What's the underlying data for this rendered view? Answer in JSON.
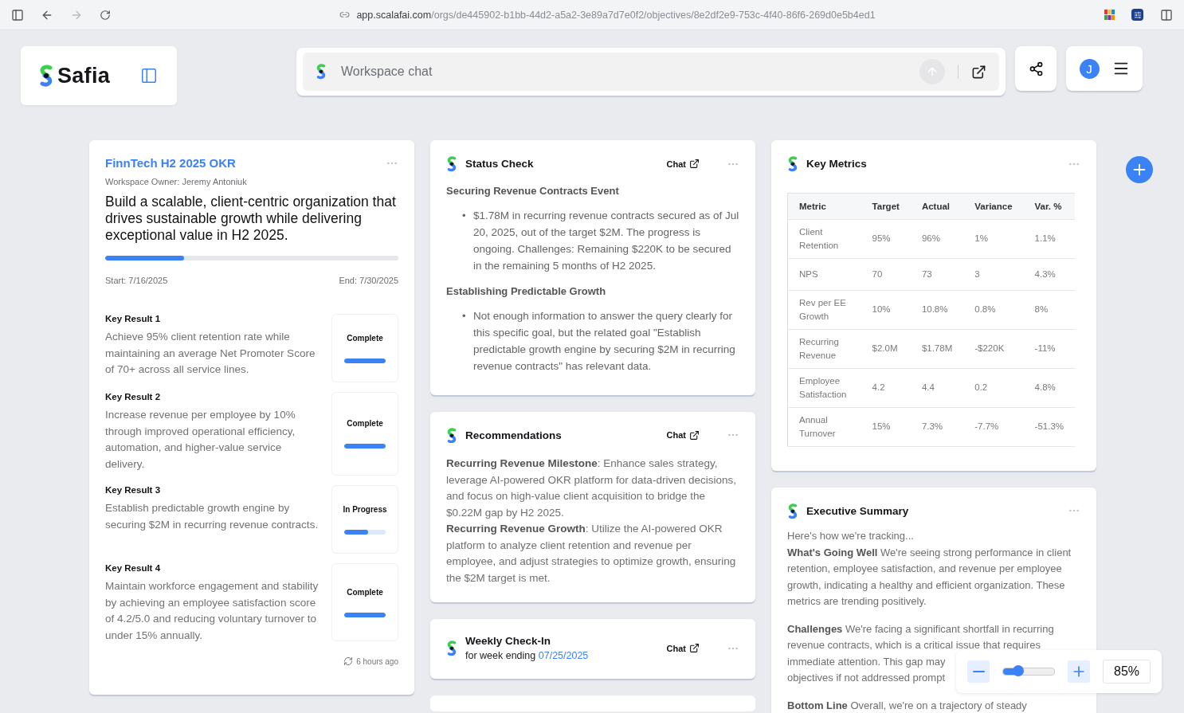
{
  "browser": {
    "url": "**app.scalafai.com**/orgs/de445902-b1bb-44d2-a5a2-3e89a7d7e0f2/objectives/8e2df2e9-753c-4f40-86f6-269d0e5b4ed1",
    "forward_disabled": true
  },
  "brand": {
    "name": "Safia"
  },
  "chat_bar": {
    "placeholder": "Workspace chat",
    "send_disabled": true
  },
  "user": {
    "avatar": "J"
  },
  "objective": {
    "title": "FinnTech H2 2025 OKR",
    "owner": "Workspace Owner: Jeremy Antoniuk",
    "statement": "Build a scalable, client-centric organization that drives sustainable growth while delivering exceptional value in H2 2025.",
    "level": 0.27,
    "start": "Start: 7/16/2025",
    "end": "End: 7/30/2025",
    "key_results": [
      {
        "label": "Key Result 1",
        "text": "Achieve 95% client retention rate while maintaining an average Net Promoter Score of 70+ across all service lines.",
        "status": "Complete",
        "level": 1
      },
      {
        "label": "Key Result 2",
        "text": "Increase revenue per employee by 10% through improved operational efficiency, automation, and higher-value service delivery.",
        "status": "Complete",
        "level": 1
      },
      {
        "label": "Key Result 3",
        "text": "Establish predictable growth engine by securing $2M in recurring revenue contracts.",
        "status": "In Progress",
        "level": 0.58
      },
      {
        "label": "Key Result 4",
        "text": "Maintain workforce engagement and stability by achieving an employee satisfaction score of 4.2/5.0 and reducing voluntary turnover to under 15% annually.",
        "status": "Complete",
        "level": 1
      }
    ],
    "updated": "6 hours ago"
  },
  "status_check": {
    "title": "Status Check",
    "chat": "Chat",
    "marker": "•",
    "sections": [
      {
        "heading": "Securing Revenue Contracts Event",
        "bullets": [
          "$1.78M in recurring revenue contracts secured as of Jul 20, 2025, out of the target $2M. The progress is ongoing. Challenges: Remaining $220K to be secured in the remaining 5 months of H2 2025."
        ]
      },
      {
        "heading": "Establishing Predictable Growth",
        "bullets": [
          "Not enough information to answer the query clearly for this specific goal, but the related goal \"Establish predictable growth engine by securing $2M in recurring revenue contracts\" has relevant data."
        ]
      }
    ]
  },
  "recommendations": {
    "title": "Recommendations",
    "chat": "Chat",
    "paragraphs": [
      "**Recurring Revenue Milestone**: Enhance sales strategy, leverage AI-powered OKR platform for data-driven decisions, and focus on high-value client acquisition to bridge the $0.22M gap by H2 2025.",
      "**Recurring Revenue Growth**: Utilize the AI-powered OKR platform to analyze client retention and revenue per employee, and adjust strategies to optimize growth, ensuring the $2M target is met."
    ]
  },
  "weekly_checkin": {
    "title": "Weekly Check-In",
    "subtitle": "for week ending",
    "date": "07/25/2025",
    "chat": "Chat"
  },
  "key_metrics": {
    "title": "Key Metrics",
    "columns": [
      "Metric",
      "Target",
      "Actual",
      "Variance",
      "Var. %"
    ],
    "rows": [
      [
        "Client Retention",
        "95%",
        "96%",
        "1%",
        "1.1%"
      ],
      [
        "NPS",
        "70",
        "73",
        "3",
        "4.3%"
      ],
      [
        "Rev per EE Growth",
        "10%",
        "10.8%",
        "0.8%",
        "8%"
      ],
      [
        "Recurring Revenue",
        "$2.0M",
        "$1.78M",
        "-$220K",
        "-11%"
      ],
      [
        "Employee Satisfaction",
        "4.2",
        "4.4",
        "0.2",
        "4.8%"
      ],
      [
        "Annual Turnover",
        "15%",
        "7.3%",
        "-7.7%",
        "-51.3%"
      ]
    ]
  },
  "executive_summary": {
    "title": "Executive Summary",
    "paragraphs": [
      [
        "Here's how we're tracking...",
        "**What's Going Well** We're seeing strong performance in client retention, employee satisfaction, and revenue per employee growth, indicating a healthy and efficient organization. These metrics are trending positively."
      ],
      [
        "**Challenges** We're facing a significant shortfall in recurring revenue contracts, which is a critical issue that requires",
        "immediate attention. This gap may",
        "objectives if not addressed prompt"
      ],
      [
        "**Bottom Line** Overall, we're on a trajectory of steady"
      ]
    ]
  },
  "zoom": {
    "level": 0.3,
    "value": "85%"
  }
}
